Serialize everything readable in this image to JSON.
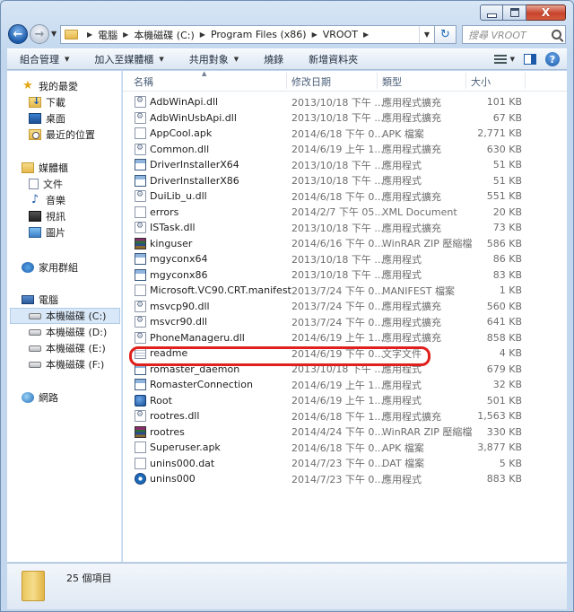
{
  "caption": {
    "close_label": "X"
  },
  "nav": {
    "back_symbol": "←",
    "fwd_symbol": "→"
  },
  "address": {
    "crumbs": [
      "電腦",
      "本機磁碟 (C:)",
      "Program Files (x86)",
      "VROOT"
    ]
  },
  "search": {
    "placeholder": "搜尋 VROOT"
  },
  "toolbar": {
    "organize": "組合管理",
    "add_to_library": "加入至媒體櫃",
    "share": "共用對象",
    "burn": "燒錄",
    "new_folder": "新增資料夾",
    "help": "?"
  },
  "sidebar": {
    "favorites": "我的最愛",
    "downloads": "下載",
    "desktop": "桌面",
    "recent": "最近的位置",
    "libraries": "媒體櫃",
    "documents": "文件",
    "music": "音樂",
    "videos": "視訊",
    "pictures": "圖片",
    "homegroup": "家用群組",
    "computer": "電腦",
    "drive_c": "本機磁碟 (C:)",
    "drive_d": "本機磁碟 (D:)",
    "drive_e": "本機磁碟 (E:)",
    "drive_f": "本機磁碟 (F:)",
    "network": "網路"
  },
  "columns": {
    "name": "名稱",
    "date": "修改日期",
    "type": "類型",
    "size": "大小"
  },
  "files": [
    {
      "name": "AdbWinApi.dll",
      "date": "2013/10/18 下午 ...",
      "type": "應用程式擴充",
      "size": "101 KB",
      "icon": "dll-icon"
    },
    {
      "name": "AdbWinUsbApi.dll",
      "date": "2013/10/18 下午 ...",
      "type": "應用程式擴充",
      "size": "67 KB",
      "icon": "dll-icon"
    },
    {
      "name": "AppCool.apk",
      "date": "2014/6/18 下午 0...",
      "type": "APK 檔案",
      "size": "2,771 KB",
      "icon": "apk-icon"
    },
    {
      "name": "Common.dll",
      "date": "2014/6/19 上午 1...",
      "type": "應用程式擴充",
      "size": "630 KB",
      "icon": "dll-icon"
    },
    {
      "name": "DriverInstallerX64",
      "date": "2013/10/18 下午 ...",
      "type": "應用程式",
      "size": "51 KB",
      "icon": "exe-icon"
    },
    {
      "name": "DriverInstallerX86",
      "date": "2013/10/18 下午 ...",
      "type": "應用程式",
      "size": "51 KB",
      "icon": "exe-icon"
    },
    {
      "name": "DuiLib_u.dll",
      "date": "2014/6/18 下午 0...",
      "type": "應用程式擴充",
      "size": "551 KB",
      "icon": "dll-icon"
    },
    {
      "name": "errors",
      "date": "2014/2/7 下午 05...",
      "type": "XML Document",
      "size": "20 KB",
      "icon": "xml-icon"
    },
    {
      "name": "ISTask.dll",
      "date": "2013/10/18 下午 ...",
      "type": "應用程式擴充",
      "size": "73 KB",
      "icon": "dll-icon"
    },
    {
      "name": "kinguser",
      "date": "2014/6/16 下午 0...",
      "type": "WinRAR ZIP 壓縮檔",
      "size": "586 KB",
      "icon": "winrar-icon"
    },
    {
      "name": "mgyconx64",
      "date": "2013/10/18 下午 ...",
      "type": "應用程式",
      "size": "86 KB",
      "icon": "exe-icon"
    },
    {
      "name": "mgyconx86",
      "date": "2013/10/18 下午 ...",
      "type": "應用程式",
      "size": "83 KB",
      "icon": "exe-icon"
    },
    {
      "name": "Microsoft.VC90.CRT.manifest",
      "date": "2013/7/24 下午 0...",
      "type": "MANIFEST 檔案",
      "size": "1 KB",
      "icon": "file-icon"
    },
    {
      "name": "msvcp90.dll",
      "date": "2013/7/24 下午 0...",
      "type": "應用程式擴充",
      "size": "560 KB",
      "icon": "dll-icon"
    },
    {
      "name": "msvcr90.dll",
      "date": "2013/7/24 下午 0...",
      "type": "應用程式擴充",
      "size": "641 KB",
      "icon": "dll-icon"
    },
    {
      "name": "PhoneManageru.dll",
      "date": "2014/6/19 上午 1...",
      "type": "應用程式擴充",
      "size": "858 KB",
      "icon": "dll-icon"
    },
    {
      "name": "readme",
      "date": "2014/6/19 下午 0...",
      "type": "文字文件",
      "size": "4 KB",
      "icon": "text-file-icon"
    },
    {
      "name": "romaster_daemon",
      "date": "2013/10/18 下午 ...",
      "type": "應用程式",
      "size": "679 KB",
      "icon": "exe-icon"
    },
    {
      "name": "RomasterConnection",
      "date": "2014/6/19 上午 1...",
      "type": "應用程式",
      "size": "32 KB",
      "icon": "exe-icon"
    },
    {
      "name": "Root",
      "date": "2014/6/19 上午 1...",
      "type": "應用程式",
      "size": "501 KB",
      "icon": "root-app-icon"
    },
    {
      "name": "rootres.dll",
      "date": "2014/6/18 下午 1...",
      "type": "應用程式擴充",
      "size": "1,563 KB",
      "icon": "dll-icon"
    },
    {
      "name": "rootres",
      "date": "2014/4/24 下午 0...",
      "type": "WinRAR ZIP 壓縮檔",
      "size": "330 KB",
      "icon": "winrar-icon"
    },
    {
      "name": "Superuser.apk",
      "date": "2014/6/18 下午 0...",
      "type": "APK 檔案",
      "size": "3,877 KB",
      "icon": "apk-icon"
    },
    {
      "name": "unins000.dat",
      "date": "2014/7/23 下午 0...",
      "type": "DAT 檔案",
      "size": "5 KB",
      "icon": "file-icon"
    },
    {
      "name": "unins000",
      "date": "2014/7/23 下午 0...",
      "type": "應用程式",
      "size": "883 KB",
      "icon": "uninstaller-icon"
    }
  ],
  "status": {
    "item_count": "25 個項目"
  },
  "colors": {
    "highlight_ring": "#e0201c",
    "selection": "#d9e8f8",
    "accent": "#1c5aa9"
  }
}
